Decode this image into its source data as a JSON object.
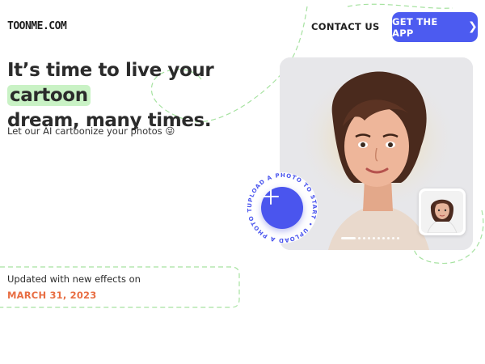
{
  "header": {
    "logo": "TOONME.COM",
    "contact": "CONTACT US",
    "cta": "GET THE APP",
    "cta_icon": "chevron-right-icon"
  },
  "hero": {
    "headline_before": "It’s time to live your ",
    "headline_highlight": "cartoon",
    "headline_after": "dream, many times.",
    "subtext": "Let our AI cartoonize your photos 😜"
  },
  "upload": {
    "ring_text": "UPLOAD A PHOTO TO START • UPLOAD A PHOTO TO START •",
    "icon": "plus-icon"
  },
  "carousel": {
    "slides": 10,
    "active_index": 0
  },
  "update": {
    "label": "Updated with new effects on",
    "date": "MARCH 31, 2023"
  },
  "colors": {
    "accent": "#4c5bf0",
    "highlight": "#c9f2c5",
    "date": "#e86e43",
    "dashed_line": "#9fe09a"
  }
}
